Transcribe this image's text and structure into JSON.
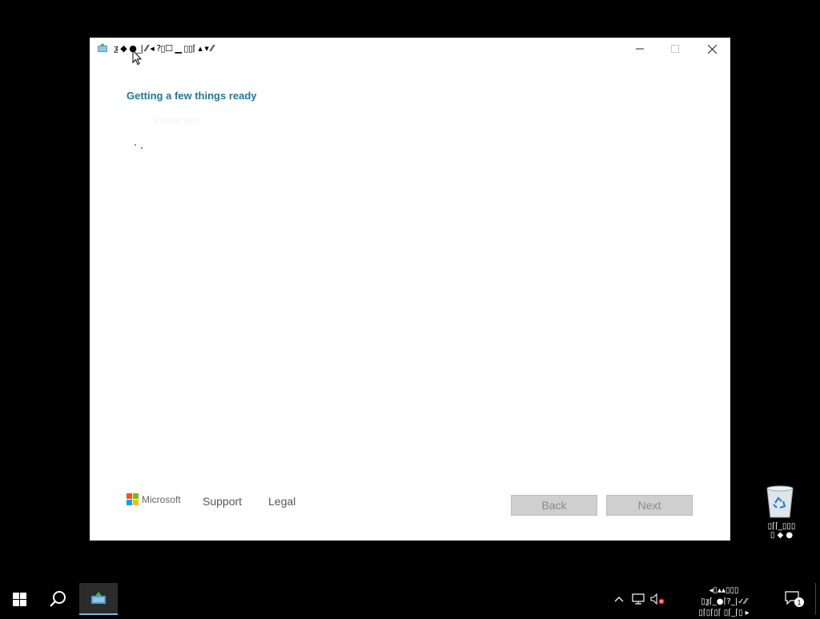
{
  "window": {
    "title_text": "ƺ ◆ ●_| ⁄⁄ ◂ ?▯☐ ▁ ▯▯⌈ ▴ ▾ ⁄⁄",
    "heading": "Getting a few things ready",
    "faint_text": "Please wait",
    "controls": {
      "minimize_icon": "minimize-icon",
      "maximize_icon": "maximize-icon",
      "close_icon": "close-icon"
    }
  },
  "footer": {
    "brand": "Microsoft",
    "links": [
      {
        "label": "Support"
      },
      {
        "label": "Legal"
      }
    ],
    "buttons": {
      "back": "Back",
      "next": "Next"
    }
  },
  "desktop": {
    "recycle_bin_label": "▯⌈⌈_▯▯▯\n▯ ◆ ●"
  },
  "taskbar": {
    "clock_line1": "◂▯▴▴▯▯▯",
    "clock_line2": "▯ƺ⌈_●⌈?_|✓⁄⁄",
    "clock_line3": "▯⌈▯⌈▯⌈ ▯⌈_⌈▯ ▸",
    "notification_count": "1"
  },
  "colors": {
    "accent_heading": "#1a7a9c",
    "ms_red": "#f25022",
    "ms_green": "#7fba00",
    "ms_blue": "#00a4ef",
    "ms_yellow": "#ffb900",
    "button_bg": "#cfcfcf",
    "taskbar_active": "#2b2b2b"
  }
}
